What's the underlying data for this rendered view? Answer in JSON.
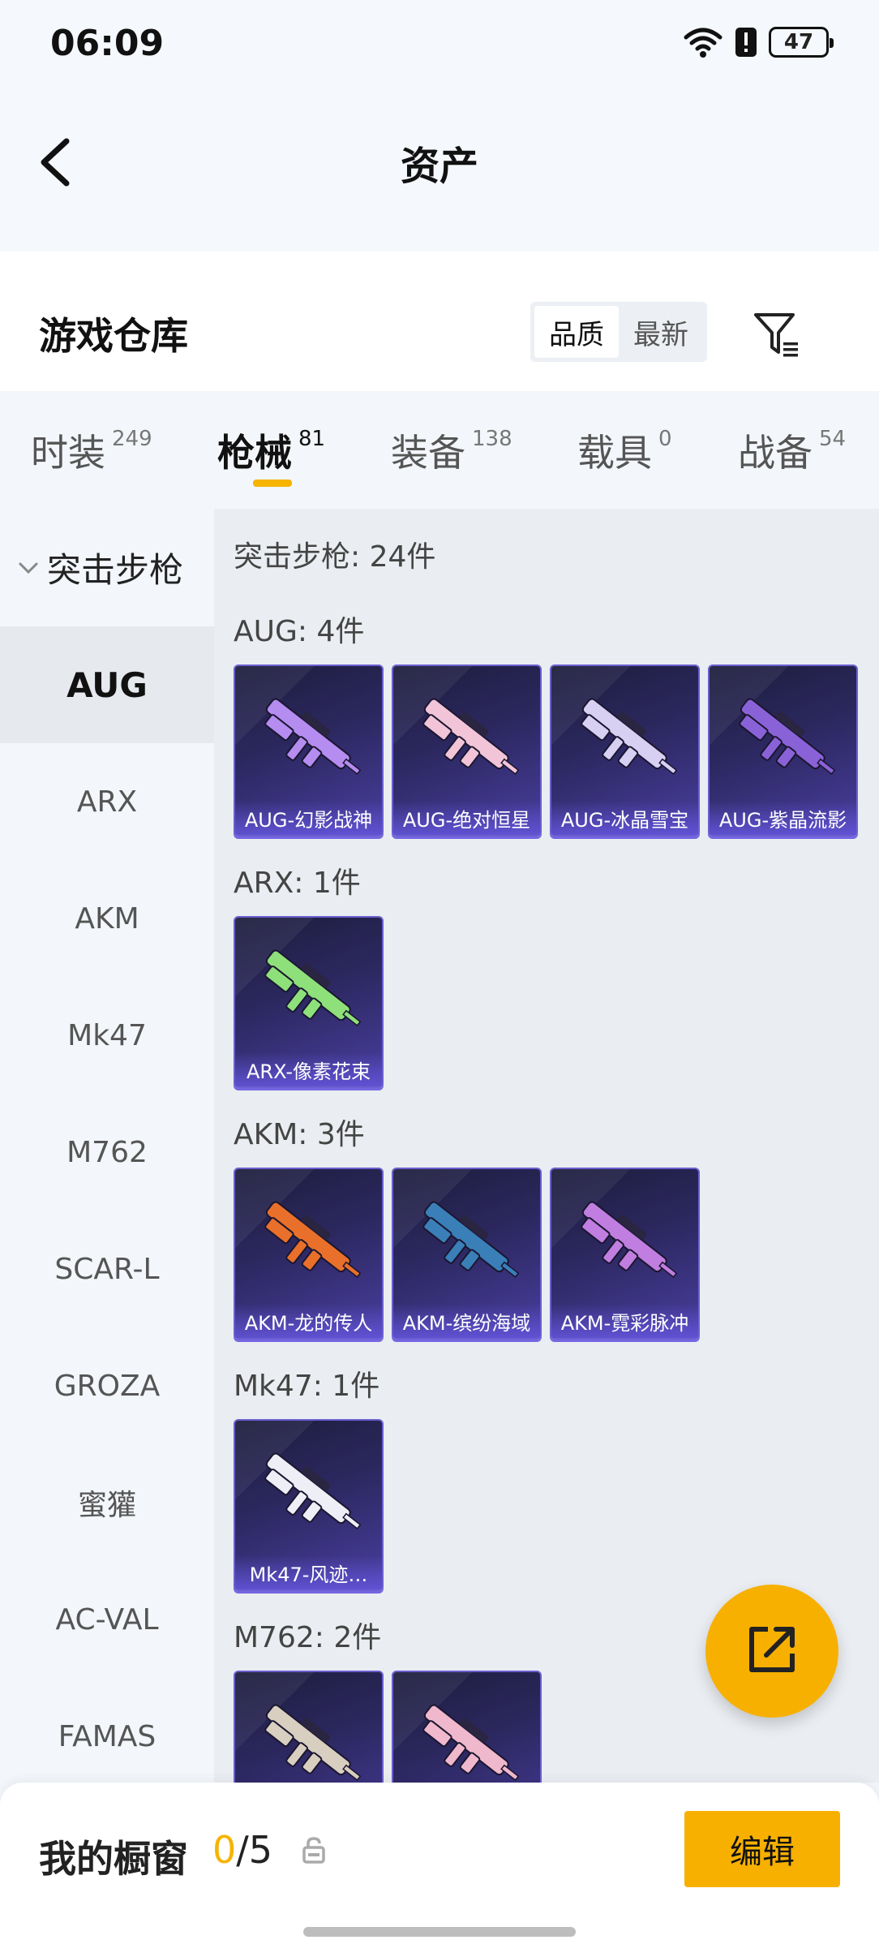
{
  "status": {
    "time": "06:09",
    "battery": "47"
  },
  "nav": {
    "title": "资产"
  },
  "warehouse": {
    "title": "游戏仓库",
    "sort_options": [
      "品质",
      "最新"
    ],
    "active_sort": "品质"
  },
  "tabs": [
    {
      "label": "时装",
      "count": "249"
    },
    {
      "label": "枪械",
      "count": "81",
      "active": true
    },
    {
      "label": "装备",
      "count": "138"
    },
    {
      "label": "载具",
      "count": "0"
    },
    {
      "label": "战备",
      "count": "54"
    }
  ],
  "sidebar": {
    "group": "突击步枪",
    "items": [
      "AUG",
      "ARX",
      "AKM",
      "Mk47",
      "M762",
      "SCAR-L",
      "GROZA",
      "蜜獾",
      "AC-VAL",
      "FAMAS"
    ],
    "active": "AUG"
  },
  "content": {
    "summary": "突击步枪: 24件",
    "sections": [
      {
        "title": "AUG: 4件",
        "items": [
          "AUG-幻影战神",
          "AUG-绝对恒星",
          "AUG-冰晶雪宝",
          "AUG-紫晶流影"
        ]
      },
      {
        "title": "ARX: 1件",
        "items": [
          "ARX-像素花束"
        ]
      },
      {
        "title": "AKM: 3件",
        "items": [
          "AKM-龙的传人",
          "AKM-缤纷海域",
          "AKM-霓彩脉冲"
        ]
      },
      {
        "title": "Mk47: 1件",
        "items": [
          "Mk47-风迹…"
        ]
      },
      {
        "title": "M762: 2件",
        "items": [
          "",
          ""
        ]
      }
    ]
  },
  "bottom": {
    "label": "我的橱窗",
    "count_current": "0",
    "count_total": "/5",
    "edit_label": "编辑"
  },
  "colors": {
    "accent": "#f7b000",
    "card_gradient_end": "#4a3ea0"
  },
  "icons": [
    "wifi-icon",
    "alert-icon",
    "back-icon",
    "filter-icon",
    "chevron-down-icon",
    "share-icon",
    "lock-icon"
  ]
}
